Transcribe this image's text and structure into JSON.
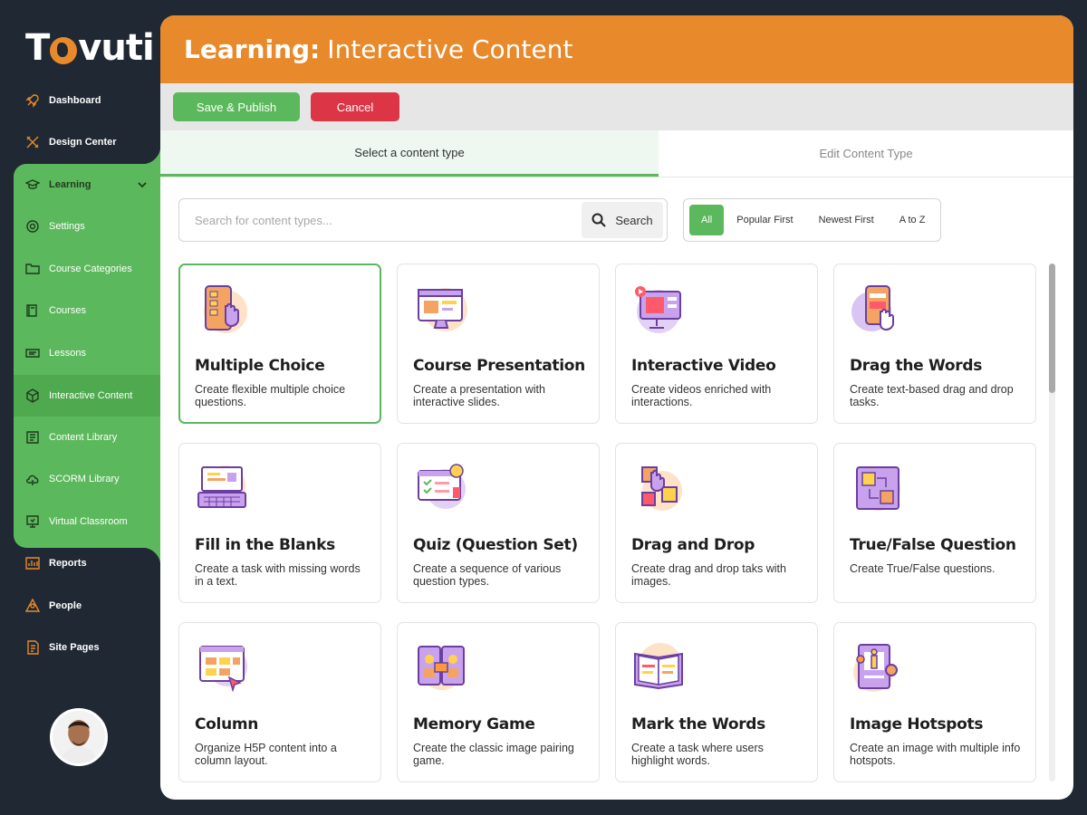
{
  "brand": {
    "logo_text_pre": "T",
    "logo_text_post": "vuti"
  },
  "sidebar": {
    "items": [
      {
        "label": "Dashboard",
        "icon": "rocket-icon"
      },
      {
        "label": "Design Center",
        "icon": "tools-icon"
      },
      {
        "label": "Learning",
        "icon": "graduation-cap-icon"
      },
      {
        "label": "Settings",
        "icon": "gear-icon"
      },
      {
        "label": "Course Categories",
        "icon": "folder-icon"
      },
      {
        "label": "Courses",
        "icon": "book-icon"
      },
      {
        "label": "Lessons",
        "icon": "slides-icon"
      },
      {
        "label": "Interactive Content",
        "icon": "cube-icon"
      },
      {
        "label": "Content Library",
        "icon": "library-icon"
      },
      {
        "label": "SCORM Library",
        "icon": "cloud-icon"
      },
      {
        "label": "Virtual Classroom",
        "icon": "presentation-icon"
      },
      {
        "label": "Reports",
        "icon": "chart-icon"
      },
      {
        "label": "People",
        "icon": "people-icon"
      },
      {
        "label": "Site Pages",
        "icon": "pages-icon"
      }
    ]
  },
  "header": {
    "title_bold": "Learning:",
    "title_rest": "Interactive Content"
  },
  "toolbar": {
    "save_label": "Save & Publish",
    "cancel_label": "Cancel"
  },
  "tabs": {
    "select": "Select a content type",
    "edit": "Edit Content Type"
  },
  "search": {
    "placeholder": "Search for content types...",
    "button_label": "Search"
  },
  "sort": {
    "all": "All",
    "popular": "Popular First",
    "newest": "Newest First",
    "az": "A to Z"
  },
  "cards": [
    {
      "title": "Multiple Choice",
      "desc": "Create flexible multiple choice questions."
    },
    {
      "title": "Course Presentation",
      "desc": "Create a presentation with interactive slides."
    },
    {
      "title": "Interactive Video",
      "desc": "Create videos enriched with interactions."
    },
    {
      "title": "Drag the Words",
      "desc": "Create text-based drag and drop tasks."
    },
    {
      "title": "Fill in the Blanks",
      "desc": "Create a task with missing words in a text."
    },
    {
      "title": "Quiz (Question Set)",
      "desc": "Create a sequence of various question types."
    },
    {
      "title": "Drag and Drop",
      "desc": "Create drag and drop taks with images."
    },
    {
      "title": "True/False Question",
      "desc": "Create True/False questions."
    },
    {
      "title": "Column",
      "desc": "Organize H5P content into a column layout."
    },
    {
      "title": "Memory Game",
      "desc": "Create the classic image pairing game."
    },
    {
      "title": "Mark the Words",
      "desc": "Create a task where users highlight words."
    },
    {
      "title": "Image Hotspots",
      "desc": "Create an image with multiple info hotspots."
    }
  ],
  "colors": {
    "accent_orange": "#e8892b",
    "accent_green": "#5cb85c",
    "danger": "#dc3545",
    "sidebar_bg": "#1f2833"
  }
}
